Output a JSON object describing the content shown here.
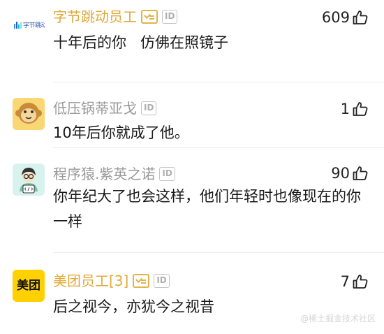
{
  "comments": [
    {
      "author": "字节跳动员工",
      "avatar_text": "字节跳动",
      "likes": "609",
      "content": "十年后的你   仿佛在照镜子",
      "id_badge": "ID"
    },
    {
      "author": "低压锅蒂亚戈",
      "likes": "1",
      "content": "10年后你就成了他。",
      "id_badge": "ID"
    },
    {
      "author": "程序猿.紫英之诺",
      "likes": "90",
      "content": "你年纪大了也会这样，他们年轻时也像现在的你一样",
      "id_badge": "ID"
    },
    {
      "author": "美团员工[3]",
      "avatar_text": "美团",
      "likes": "7",
      "content": "后之视今，亦犹今之视昔",
      "id_badge": "ID"
    }
  ],
  "watermark": "@稀土掘金技术社区",
  "colors": {
    "brand_name": "#e0a93a",
    "plain_name": "#9a9a9a",
    "text": "#1a1a1a",
    "meituan_yellow": "#ffd100"
  },
  "icons": {
    "like": "thumbs-up-icon",
    "certified": "certified-tag-icon"
  }
}
